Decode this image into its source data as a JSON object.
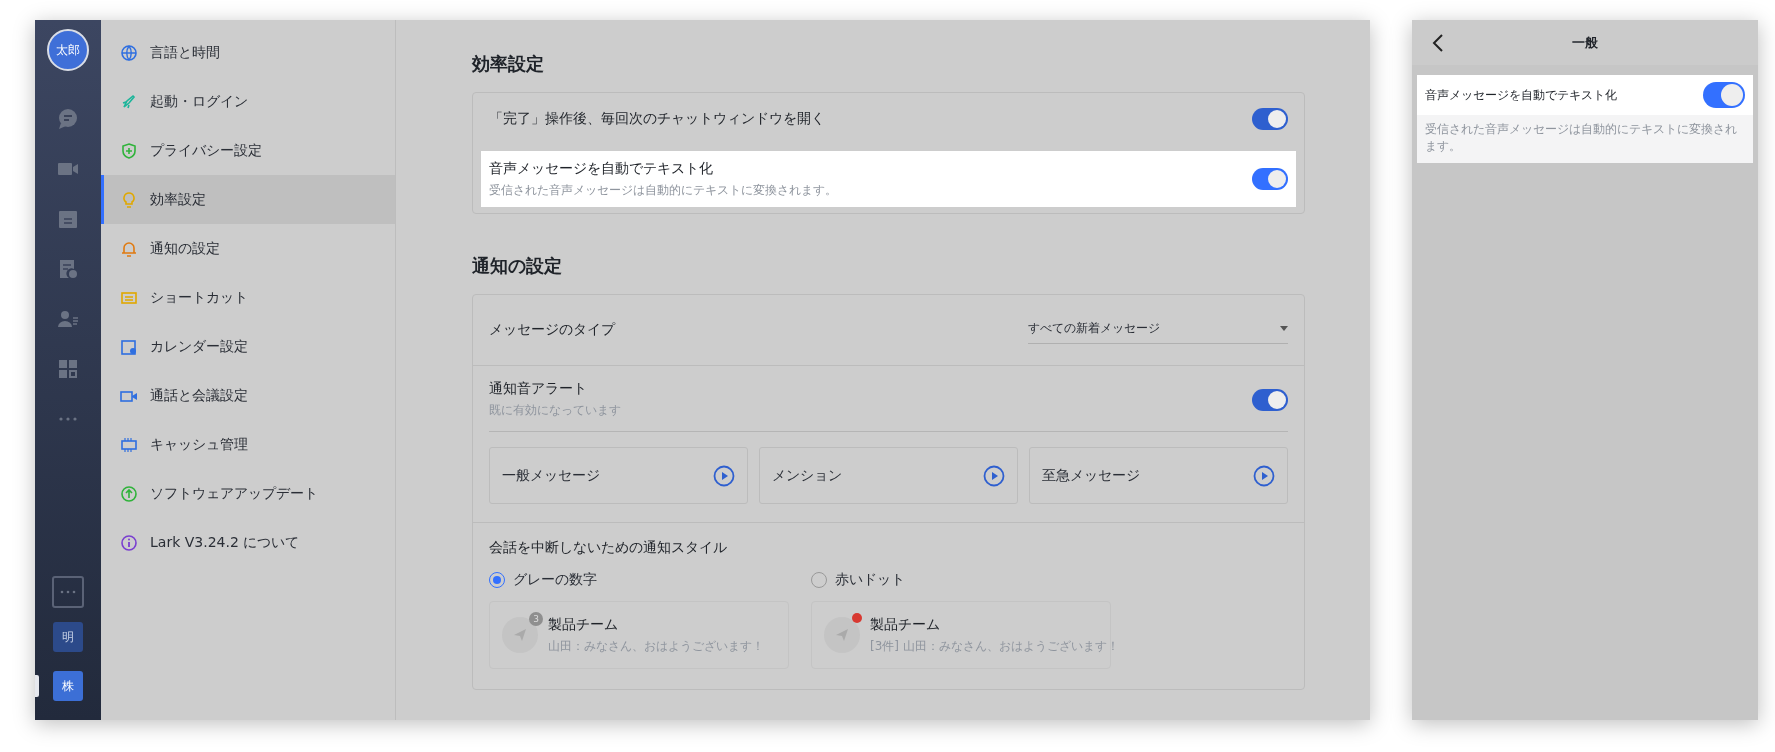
{
  "rail": {
    "avatar": "太郎",
    "workspaces": [
      {
        "label": "明",
        "selected": false
      },
      {
        "label": "株",
        "selected": true
      }
    ]
  },
  "sidebar": {
    "items": [
      {
        "label": "言語と時間",
        "selected": false
      },
      {
        "label": "起動・ログイン",
        "selected": false
      },
      {
        "label": "プライバシー設定",
        "selected": false
      },
      {
        "label": "効率設定",
        "selected": true
      },
      {
        "label": "通知の設定",
        "selected": false
      },
      {
        "label": "ショートカット",
        "selected": false
      },
      {
        "label": "カレンダー設定",
        "selected": false
      },
      {
        "label": "通話と会議設定",
        "selected": false
      },
      {
        "label": "キャッシュ管理",
        "selected": false
      },
      {
        "label": "ソフトウェアアップデート",
        "selected": false
      },
      {
        "label": "Lark V3.24.2 について",
        "selected": false
      }
    ]
  },
  "efficiency": {
    "title": "効率設定",
    "rows": [
      {
        "label": "「完了」操作後、毎回次のチャットウィンドウを開く",
        "on": true,
        "highlighted": false
      },
      {
        "label": "音声メッセージを自動でテキスト化",
        "description": "受信された音声メッセージは自動的にテキストに変換されます。",
        "on": true,
        "highlighted": true
      }
    ]
  },
  "notifications": {
    "title": "通知の設定",
    "message_type": {
      "label": "メッセージのタイプ",
      "value": "すべての新着メッセージ"
    },
    "alert": {
      "label": "通知音アラート",
      "description": "既に有効になっています",
      "on": true
    },
    "sounds": [
      "一般メッセージ",
      "メンション",
      "至急メッセージ"
    ],
    "style": {
      "label": "会話を中断しないための通知スタイル",
      "options": [
        {
          "label": "グレーの数字",
          "selected": true,
          "kind": "count",
          "badge": "3",
          "title": "製品チーム",
          "message": "山田：みなさん、おはようございます！"
        },
        {
          "label": "赤いドット",
          "selected": false,
          "kind": "dot",
          "title": "製品チーム",
          "message": "[3件] 山田：みなさん、おはようございます！"
        }
      ]
    }
  },
  "phone": {
    "title": "一般",
    "row": {
      "label": "音声メッセージを自動でテキスト化",
      "on": true,
      "highlighted": true
    },
    "description": "受信された音声メッセージは自動的にテキストに変換されます。"
  }
}
